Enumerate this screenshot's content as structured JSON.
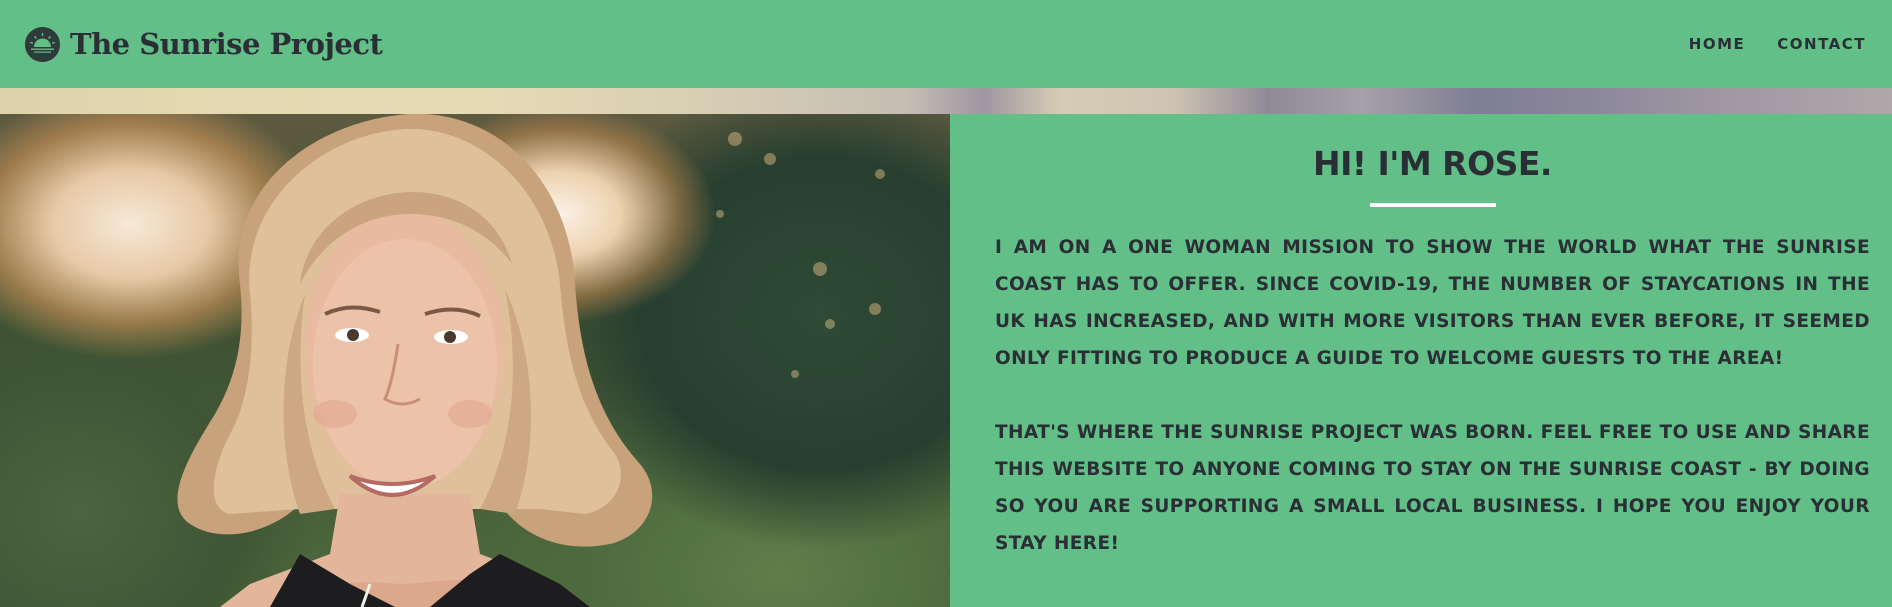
{
  "header": {
    "brand_title": "The Sunrise Project",
    "logo_icon": "sunrise-logo-icon",
    "nav": [
      {
        "label": "Home"
      },
      {
        "label": "Contact"
      }
    ]
  },
  "about": {
    "heading": "Hi! I'm Rose.",
    "paragraphs": [
      "I am on a one woman mission to show the world what the Sunrise Coast has to offer. Since Covid-19, the number of staycations in the UK has increased, and with more visitors than ever before, it seemed only fitting to produce a guide to welcome guests to the area!",
      "That's where The Sunrise Project was born. Feel free to use and share this website to anyone coming to stay on the Sunrise Coast - by doing so you are supporting a small local business. I hope you enjoy your stay here!"
    ]
  },
  "colors": {
    "background": "#62bf87",
    "text": "#2a2f36",
    "divider": "#ffffff"
  }
}
